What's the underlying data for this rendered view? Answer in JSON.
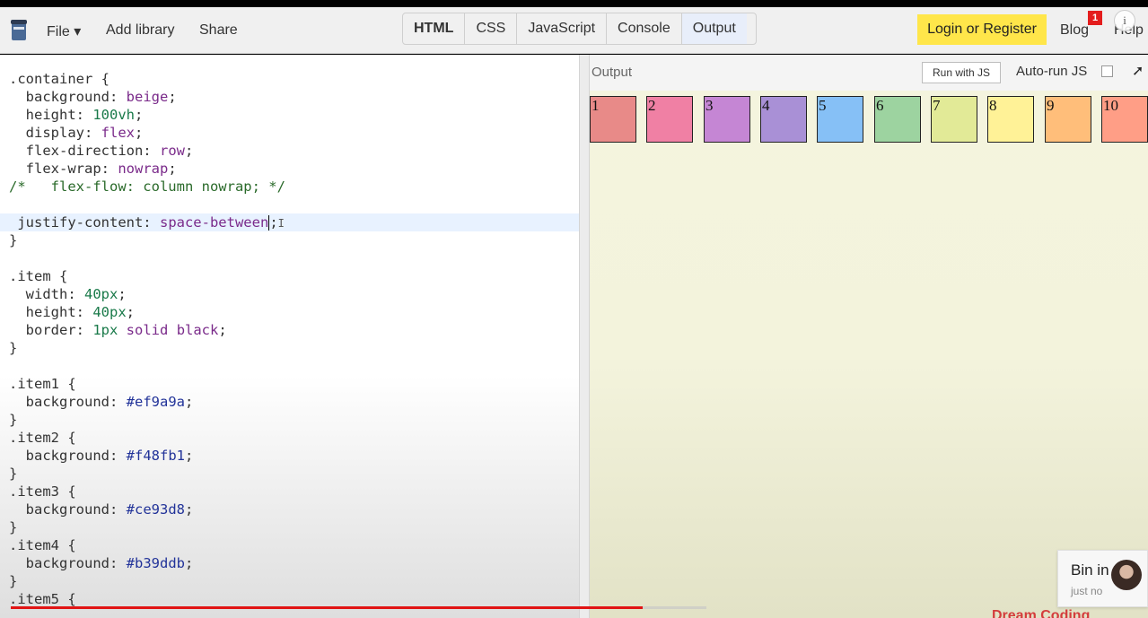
{
  "topbar": {
    "menu": [
      {
        "label": "File ▾"
      },
      {
        "label": "Add library"
      },
      {
        "label": "Share"
      }
    ],
    "tabs": [
      {
        "label": "HTML"
      },
      {
        "label": "CSS"
      },
      {
        "label": "JavaScript"
      },
      {
        "label": "Console"
      },
      {
        "label": "Output"
      }
    ],
    "login_label": "Login or Register",
    "blog_label": "Blog",
    "blog_badge": "1",
    "help_label": "Help",
    "info_glyph": "i"
  },
  "editor": {
    "lines": [
      ".container {",
      "  background: beige;",
      "  height: 100vh;",
      "  display: flex;",
      "  flex-direction: row;",
      "  flex-wrap: nowrap;",
      "/*   flex-flow: column nowrap; */",
      "",
      " justify-content: space-between;",
      "}",
      "",
      ".item {",
      "  width: 40px;",
      "  height: 40px;",
      "  border: 1px solid black;",
      "}",
      "",
      ".item1 {",
      "  background: #ef9a9a;",
      "}",
      ".item2 {",
      "  background: #f48fb1;",
      "}",
      ".item3 {",
      "  background: #ce93d8;",
      "}",
      ".item4 {",
      "  background: #b39ddb;",
      "}",
      ".item5 {"
    ]
  },
  "output": {
    "label": "Output",
    "run_label": "Run with JS",
    "autorun_label": "Auto-run JS",
    "items": [
      {
        "label": "1",
        "color": "#e88a88"
      },
      {
        "label": "2",
        "color": "#f080a4"
      },
      {
        "label": "3",
        "color": "#c586d4"
      },
      {
        "label": "4",
        "color": "#a990d6"
      },
      {
        "label": "5",
        "color": "#86c0f6"
      },
      {
        "label": "6",
        "color": "#9dd3a0"
      },
      {
        "label": "7",
        "color": "#e2ea97"
      },
      {
        "label": "8",
        "color": "#fff297"
      },
      {
        "label": "9",
        "color": "#ffbe7a"
      },
      {
        "label": "10",
        "color": "#ff9e86"
      }
    ]
  },
  "notification": {
    "name": "Bin in",
    "time": "just no"
  },
  "video": {
    "brand": "Dream Coding",
    "progress": 0.909
  }
}
